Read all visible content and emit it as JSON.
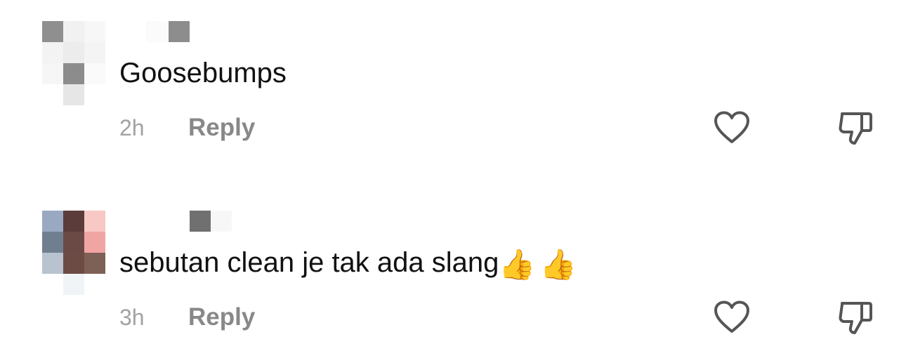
{
  "comments": [
    {
      "avatar_alt": "user avatar (pixelated)",
      "text": "Goosebumps",
      "emoji": "",
      "timestamp": "2h",
      "reply_label": "Reply",
      "like_icon": "heart-outline",
      "dislike_icon": "thumbs-down-outline"
    },
    {
      "avatar_alt": "user avatar (pixelated)",
      "text": "sebutan clean je tak ada slang",
      "emoji": "👍👍",
      "timestamp": "3h",
      "reply_label": "Reply",
      "like_icon": "heart-outline",
      "dislike_icon": "thumbs-down-outline"
    }
  ],
  "colors": {
    "comment_text": "#111111",
    "timestamp": "#a2a2a2",
    "reply": "#888888",
    "icon_stroke": "#555555"
  }
}
